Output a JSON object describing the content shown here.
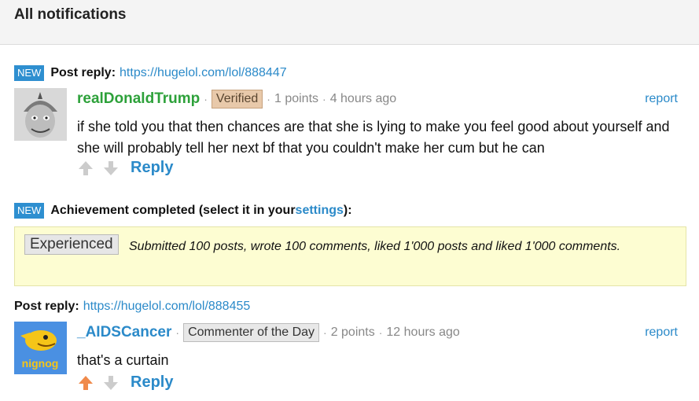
{
  "header": {
    "title": "All notifications"
  },
  "notifications": [
    {
      "new_label": "NEW",
      "heading": "Post reply:",
      "link": "https://hugelol.com/lol/888447",
      "comment": {
        "username": "realDonaldTrump",
        "tag": "Verified",
        "points": "1 points",
        "time": "4 hours ago",
        "report": "report",
        "text": "if she told you that then chances are that she is lying to make you feel good about yourself and she will probably tell her next bf that you couldn't make her cum but he can",
        "reply": "Reply",
        "upvoted": false
      }
    },
    {
      "new_label": "NEW",
      "heading_prefix": "Achievement completed (select it in your ",
      "heading_link": "settings",
      "heading_suffix": "):",
      "achievement": {
        "badge": "Experienced",
        "description": "Submitted 100 posts, wrote 100 comments, liked 1'000 posts and liked 1'000 comments."
      }
    },
    {
      "heading": "Post reply:",
      "link": "https://hugelol.com/lol/888455",
      "comment": {
        "username": "_AIDSCancer",
        "tag": "Commenter of the Day",
        "points": "2 points",
        "time": "12 hours ago",
        "report": "report",
        "text": "that's a curtain",
        "reply": "Reply",
        "upvoted": true
      }
    }
  ],
  "colors": {
    "link": "#2b8ac9",
    "new_badge": "#2e8fd0",
    "upvote_active": "#f08a4b",
    "vote_inactive": "#cccccc"
  },
  "avatars": {
    "first_label": "",
    "second_label": "nignog"
  }
}
